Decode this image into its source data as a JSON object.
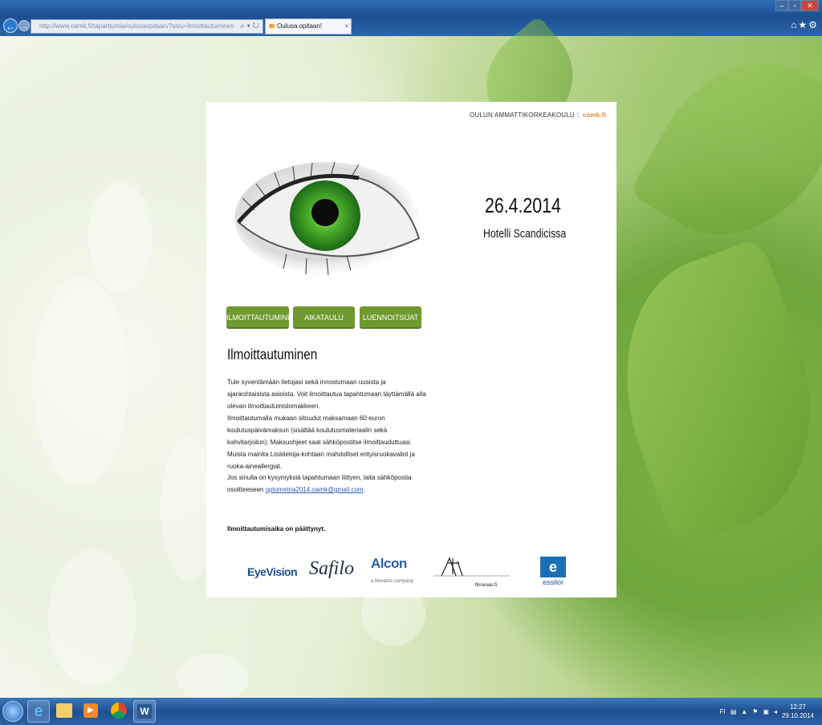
{
  "browser": {
    "url": "http://www.oamk.fi/tapahtumia/oulusaopitaan/?sivu=ilmoittautuminen",
    "tab_label": "Oulusa opitaan! Optikoiden...",
    "tab_close": "×"
  },
  "page": {
    "org": "OULUN AMMATTIKORKEAKOULU ::",
    "org_link": "oamk.fi",
    "date": "26.4.2014",
    "venue": "Hotelli Scandicissa",
    "nav": [
      "ILMOITTAUTUMINEN",
      "AIKATAULU",
      "LUENNOITSIJAT"
    ],
    "heading": "Ilmoittautuminen",
    "p1": "Tule syventämään tietojasi sekä innostumaan uusista ja ajankohtaisista asioista. Voit ilmoittautua tapahtumaan täyttämällä alla olevan ilmoittautumislomakkeen.",
    "p2": "Ilmoittautumalla mukaan sitoudut maksamaan 60 euron koulutuspäivämaksun (sisältää koulutusmateriaalin sekä kahvitarjoilun). Maksuohjeet saat sähköpostitse ilmoittauduttuasi. Muista mainita Lisätietoja-kohtaan mahdolliset erityisruokavaliot ja ruoka-aineallergiat.",
    "p3": "Jos sinulla on kysymyksiä tapahtumaan liittyen, laita sähköpostia osoitteeseen",
    "email": "optometria2014.oamk@gmail.com",
    "p3_end": ".",
    "closed": "Ilmoittautumisaika on päättynyt.",
    "logos": {
      "eyevision": "EyeVision",
      "safilo": "Safilo",
      "alcon": "Alcon",
      "alcon_sub": "a Novartis company",
      "finnvuas": "finnvuas.fi",
      "essilor": "essilor"
    }
  },
  "taskbar": {
    "lang": "FI",
    "time": "12:27",
    "date": "29.10.2014"
  },
  "colors": {
    "nav_green": "#6f9a2f",
    "org_accent": "#e8892c",
    "taskbar": "#1f4f8f"
  }
}
